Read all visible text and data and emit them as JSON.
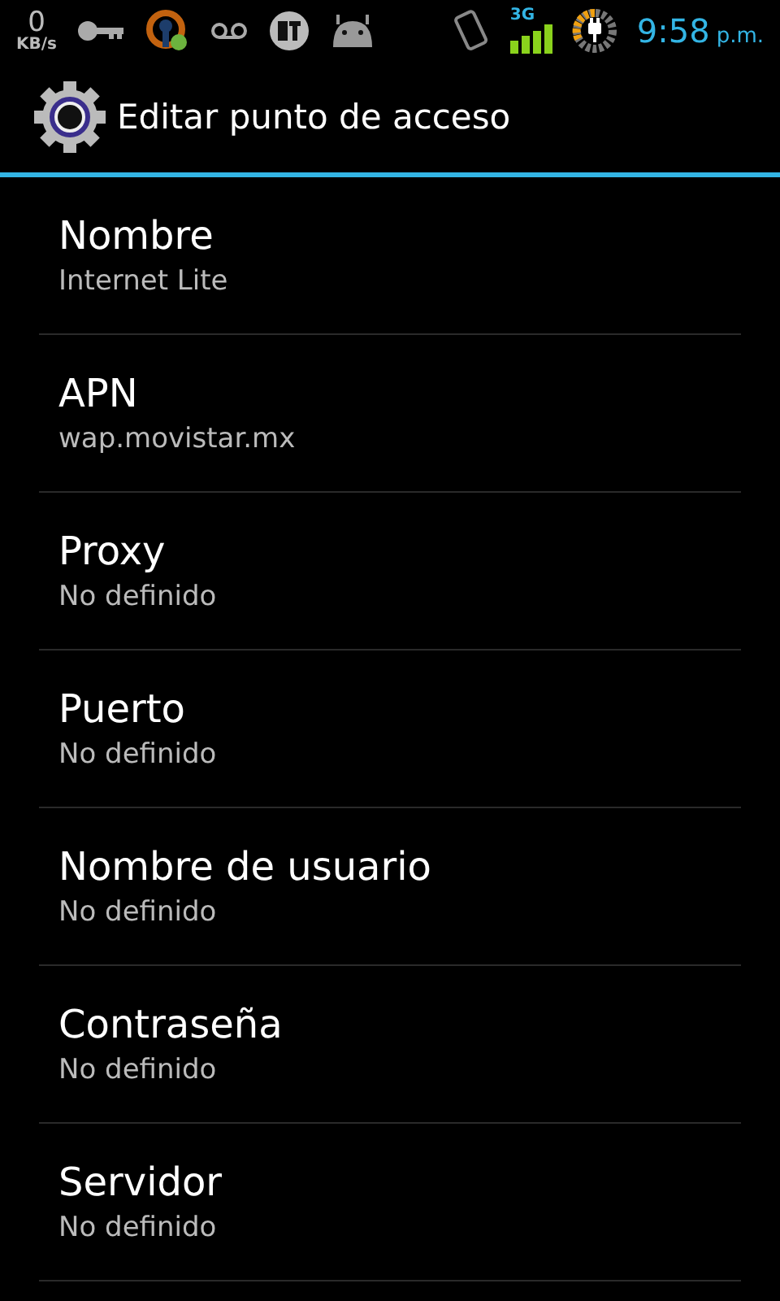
{
  "status_bar": {
    "speed_value": "0",
    "speed_unit": "KB/s",
    "network": "3G",
    "time": "9:58",
    "time_suffix": "p.m."
  },
  "action_bar": {
    "title": "Editar punto de acceso"
  },
  "preferences": [
    {
      "title": "Nombre",
      "summary": "Internet Lite"
    },
    {
      "title": "APN",
      "summary": "wap.movistar.mx"
    },
    {
      "title": "Proxy",
      "summary": "No definido"
    },
    {
      "title": "Puerto",
      "summary": "No definido"
    },
    {
      "title": "Nombre de usuario",
      "summary": "No definido"
    },
    {
      "title": "Contraseña",
      "summary": "No definido"
    },
    {
      "title": "Servidor",
      "summary": "No definido"
    }
  ]
}
